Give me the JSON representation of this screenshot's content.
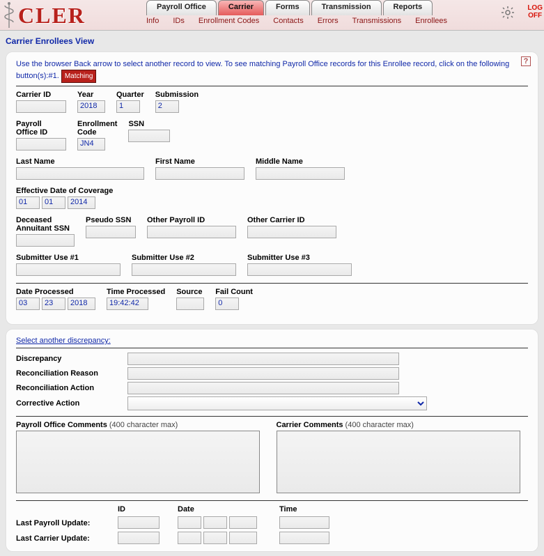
{
  "app": {
    "name": "CLER",
    "logoff": "LOG\nOFF"
  },
  "tabs": [
    "Payroll Office",
    "Carrier",
    "Forms",
    "Transmission",
    "Reports"
  ],
  "active_tab": 1,
  "subtabs": [
    "Info",
    "IDs",
    "Enrollment Codes",
    "Contacts",
    "Errors",
    "Transmissions",
    "Enrollees"
  ],
  "page_title": "Carrier Enrollees View",
  "instruction": "Use the browser Back arrow to select another record to view.   To see matching Payroll Office records for this Enrollee record, click on the following button(s):#1.",
  "matching_btn": "Matching",
  "labels": {
    "carrier_id": "Carrier ID",
    "year": "Year",
    "quarter": "Quarter",
    "submission": "Submission",
    "payroll_office_id": "Payroll\nOffice ID",
    "enrollment_code": "Enrollment\nCode",
    "ssn": "SSN",
    "last_name": "Last Name",
    "first_name": "First Name",
    "middle_name": "Middle Name",
    "eff_date": "Effective Date of Coverage",
    "deceased_ssn": "Deceased\nAnnuitant SSN",
    "pseudo_ssn": "Pseudo SSN",
    "other_payroll": "Other Payroll ID",
    "other_carrier": "Other Carrier ID",
    "sub1": "Submitter Use #1",
    "sub2": "Submitter Use #2",
    "sub3": "Submitter Use #3",
    "date_proc": "Date Processed",
    "time_proc": "Time Processed",
    "source": "Source",
    "fail_count": "Fail Count",
    "select_disc": "Select another discrepancy:",
    "discrepancy": "Discrepancy",
    "rec_reason": "Reconciliation Reason",
    "rec_action": "Reconciliation Action",
    "corrective": "Corrective Action",
    "po_comments": "Payroll Office Comments",
    "carrier_comments": "Carrier Comments",
    "char_max": " (400 character max)",
    "id": "ID",
    "date": "Date",
    "time": "Time",
    "last_payroll": "Last Payroll Update:",
    "last_carrier": "Last Carrier Update:"
  },
  "values": {
    "carrier_id": "",
    "year": "2018",
    "quarter": "1",
    "submission": "2",
    "payroll_office_id": "",
    "enrollment_code": "JN4",
    "ssn": "",
    "last_name": "",
    "first_name": "",
    "middle_name": "",
    "eff_mm": "01",
    "eff_dd": "01",
    "eff_yyyy": "2014",
    "deceased_ssn": "",
    "pseudo_ssn": "",
    "other_payroll": "",
    "other_carrier": "",
    "sub1": "",
    "sub2": "",
    "sub3": "",
    "dp_mm": "03",
    "dp_dd": "23",
    "dp_yyyy": "2018",
    "time_proc": "19:42:42",
    "source": "",
    "fail_count": "0",
    "discrepancy": "",
    "rec_reason": "",
    "rec_action": "",
    "corrective": "",
    "po_comments": "",
    "carrier_comments": "",
    "lp_id": "",
    "lp_d1": "",
    "lp_d2": "",
    "lp_d3": "",
    "lp_time": "",
    "lc_id": "",
    "lc_d1": "",
    "lc_d2": "",
    "lc_d3": "",
    "lc_time": ""
  }
}
